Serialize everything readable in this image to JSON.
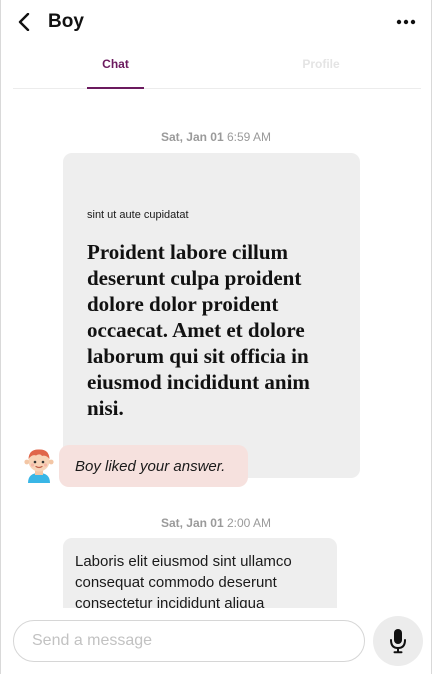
{
  "header": {
    "title": "Boy"
  },
  "tabs": [
    {
      "label": "Chat",
      "active": true
    },
    {
      "label": "Profile",
      "active": false
    }
  ],
  "messages": [
    {
      "date": "Sat, Jan 01",
      "time": "6:59 AM",
      "small_text": "sint ut aute cupidatat",
      "big_text": "Proident labore cillum deserunt culpa proident dolore dolor proident occaecat. Amet et dolore laborum qui sit officia in eiusmod incididunt anim nisi."
    },
    {
      "date": "Sat, Jan 01",
      "time": "2:00 AM",
      "text": "Laboris elit eiusmod sint ullamco consequat commodo deserunt consectetur incididunt aliqua"
    }
  ],
  "reaction": {
    "text": "Boy liked your answer."
  },
  "composer": {
    "placeholder": "Send a message"
  },
  "colors": {
    "accent": "#6b1a5e",
    "bubble": "#eeeeee",
    "reaction": "#f6e1de"
  },
  "icons": {
    "back": "chevron-left-icon",
    "more": "ellipsis-icon",
    "mic": "microphone-icon",
    "avatar": "boy-avatar"
  }
}
